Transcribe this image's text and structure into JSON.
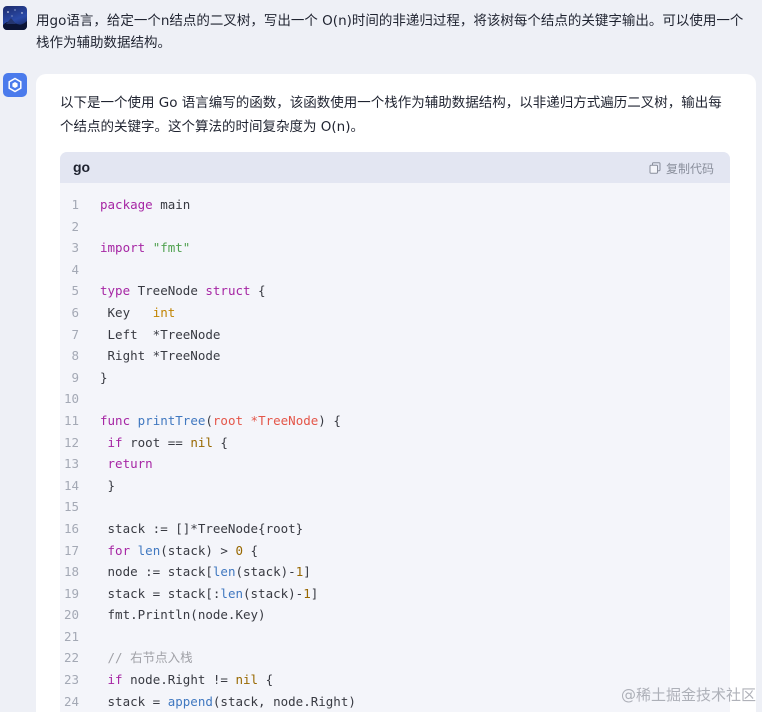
{
  "user_message": {
    "text": "用go语言，给定一个n结点的二叉树，写出一个 O(n)时间的非递归过程，将该树每个结点的关键字输出。可以使用一个栈作为辅助数据结构。"
  },
  "assistant_message": {
    "text": "以下是一个使用 Go 语言编写的函数，该函数使用一个栈作为辅助数据结构，以非递归方式遍历二叉树，输出每个结点的关键字。这个算法的时间复杂度为 O(n)。"
  },
  "code_block": {
    "language": "go",
    "copy_label": "复制代码",
    "lines": [
      {
        "num": "1",
        "tokens": [
          {
            "t": "package",
            "c": "kw"
          },
          {
            "t": " main",
            "c": ""
          }
        ]
      },
      {
        "num": "2",
        "tokens": []
      },
      {
        "num": "3",
        "tokens": [
          {
            "t": "import",
            "c": "kw"
          },
          {
            "t": " ",
            "c": ""
          },
          {
            "t": "\"fmt\"",
            "c": "str"
          }
        ]
      },
      {
        "num": "4",
        "tokens": []
      },
      {
        "num": "5",
        "tokens": [
          {
            "t": "type",
            "c": "kw"
          },
          {
            "t": " TreeNode ",
            "c": ""
          },
          {
            "t": "struct",
            "c": "kw"
          },
          {
            "t": " {",
            "c": ""
          }
        ]
      },
      {
        "num": "6",
        "tokens": [
          {
            "t": " Key   ",
            "c": ""
          },
          {
            "t": "int",
            "c": "type"
          }
        ]
      },
      {
        "num": "7",
        "tokens": [
          {
            "t": " Left  *TreeNode",
            "c": ""
          }
        ]
      },
      {
        "num": "8",
        "tokens": [
          {
            "t": " Right *TreeNode",
            "c": ""
          }
        ]
      },
      {
        "num": "9",
        "tokens": [
          {
            "t": "}",
            "c": ""
          }
        ]
      },
      {
        "num": "10",
        "tokens": []
      },
      {
        "num": "11",
        "tokens": [
          {
            "t": "func",
            "c": "kw"
          },
          {
            "t": " ",
            "c": ""
          },
          {
            "t": "printTree",
            "c": "fn"
          },
          {
            "t": "(",
            "c": ""
          },
          {
            "t": "root",
            "c": "param"
          },
          {
            "t": " *TreeNode",
            "c": "param"
          },
          {
            "t": ") {",
            "c": ""
          }
        ]
      },
      {
        "num": "12",
        "tokens": [
          {
            "t": " ",
            "c": ""
          },
          {
            "t": "if",
            "c": "kw"
          },
          {
            "t": " root == ",
            "c": ""
          },
          {
            "t": "nil",
            "c": "num"
          },
          {
            "t": " {",
            "c": ""
          }
        ]
      },
      {
        "num": "13",
        "tokens": [
          {
            "t": " ",
            "c": ""
          },
          {
            "t": "return",
            "c": "kw"
          }
        ]
      },
      {
        "num": "14",
        "tokens": [
          {
            "t": " }",
            "c": ""
          }
        ]
      },
      {
        "num": "15",
        "tokens": []
      },
      {
        "num": "16",
        "tokens": [
          {
            "t": " stack := []*TreeNode{root}",
            "c": ""
          }
        ]
      },
      {
        "num": "17",
        "tokens": [
          {
            "t": " ",
            "c": ""
          },
          {
            "t": "for",
            "c": "kw"
          },
          {
            "t": " ",
            "c": ""
          },
          {
            "t": "len",
            "c": "fn"
          },
          {
            "t": "(stack) > ",
            "c": ""
          },
          {
            "t": "0",
            "c": "num"
          },
          {
            "t": " {",
            "c": ""
          }
        ]
      },
      {
        "num": "18",
        "tokens": [
          {
            "t": " node := stack[",
            "c": ""
          },
          {
            "t": "len",
            "c": "fn"
          },
          {
            "t": "(stack)-",
            "c": ""
          },
          {
            "t": "1",
            "c": "num"
          },
          {
            "t": "]",
            "c": ""
          }
        ]
      },
      {
        "num": "19",
        "tokens": [
          {
            "t": " stack = stack[:",
            "c": ""
          },
          {
            "t": "len",
            "c": "fn"
          },
          {
            "t": "(stack)-",
            "c": ""
          },
          {
            "t": "1",
            "c": "num"
          },
          {
            "t": "]",
            "c": ""
          }
        ]
      },
      {
        "num": "20",
        "tokens": [
          {
            "t": " fmt.Println(node.Key)",
            "c": ""
          }
        ]
      },
      {
        "num": "21",
        "tokens": []
      },
      {
        "num": "22",
        "tokens": [
          {
            "t": " // 右节点入栈",
            "c": "com"
          }
        ]
      },
      {
        "num": "23",
        "tokens": [
          {
            "t": " ",
            "c": ""
          },
          {
            "t": "if",
            "c": "kw"
          },
          {
            "t": " node.Right != ",
            "c": ""
          },
          {
            "t": "nil",
            "c": "num"
          },
          {
            "t": " {",
            "c": ""
          }
        ]
      },
      {
        "num": "24",
        "tokens": [
          {
            "t": " stack = ",
            "c": ""
          },
          {
            "t": "append",
            "c": "fn"
          },
          {
            "t": "(stack, node.Right)",
            "c": ""
          }
        ]
      }
    ]
  },
  "watermark": {
    "text": "@稀土掘金技术社区"
  },
  "colors": {
    "background": "#eef0f6",
    "bubble": "#ffffff",
    "code_bg": "#f4f5fa",
    "code_header_bg": "#e3e6f2",
    "bot_avatar": "#4b7bec",
    "keyword": "#a626a4",
    "string": "#50a14f",
    "function": "#4078c0",
    "param": "#e45649",
    "number": "#986801"
  }
}
